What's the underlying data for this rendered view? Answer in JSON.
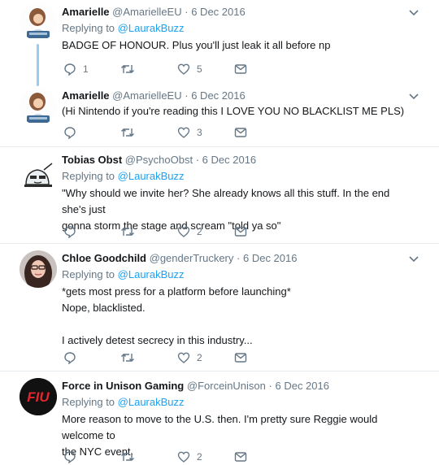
{
  "icons": {
    "reply": "reply-icon",
    "retweet": "retweet-icon",
    "like": "heart-icon",
    "dm": "envelope-icon",
    "caret": "chevron-down-icon"
  },
  "colors": {
    "link": "#1da1f2",
    "muted": "#657786",
    "thread": "#9ccbf0"
  },
  "tweets": [
    {
      "name": "Amarielle",
      "handle": "@AmarielleEU",
      "date": "6 Dec 2016",
      "replying": "Replying to",
      "replying_to": "@LaurakBuzz",
      "lines": [
        "BADGE OF HONOUR.  Plus you'll just leak it all before np"
      ],
      "replies": "1",
      "retweets": "",
      "likes": "5"
    },
    {
      "name": "Amarielle",
      "handle": "@AmarielleEU",
      "date": "6 Dec 2016",
      "replying": "",
      "replying_to": "",
      "lines": [
        "(Hi Nintendo if you're reading this I LOVE YOU NO BLACKLIST ME PLS)"
      ],
      "replies": "",
      "retweets": "",
      "likes": "3"
    },
    {
      "name": "Tobias Obst",
      "handle": "@PsychoObst",
      "date": "6 Dec 2016",
      "replying": "Replying to",
      "replying_to": "@LaurakBuzz",
      "lines": [
        "\"Why should we invite her? She already knows all this stuff. In the end she's just",
        "gonna storm the stage and scream \"told ya so\""
      ],
      "replies": "",
      "retweets": "",
      "likes": "2"
    },
    {
      "name": "Chloe Goodchild",
      "handle": "@genderTruckery",
      "date": "6 Dec 2016",
      "replying": "Replying to",
      "replying_to": "@LaurakBuzz",
      "lines": [
        "*gets most press for a platform before launching*",
        "Nope, blacklisted.",
        "",
        "I actively detest secrecy in this industry..."
      ],
      "replies": "",
      "retweets": "",
      "likes": "2"
    },
    {
      "name": "Force in Unison Gaming",
      "handle": "@ForceinUnison",
      "date": "6 Dec 2016",
      "replying": "Replying to",
      "replying_to": "@LaurakBuzz",
      "lines": [
        "More reason to move to the U.S. then. I'm pretty sure Reggie would welcome to",
        "the NYC event."
      ],
      "replies": "",
      "retweets": "",
      "likes": "2"
    }
  ],
  "avatars": {
    "fiu_text": "FIU"
  }
}
